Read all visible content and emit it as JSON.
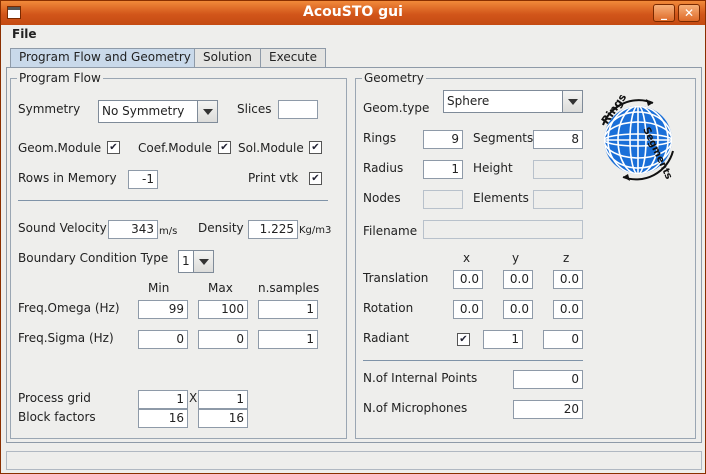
{
  "window": {
    "title": "AcouSTO gui"
  },
  "menubar": {
    "file": "File"
  },
  "tabs": [
    {
      "label": "Program Flow and Geometry",
      "active": true
    },
    {
      "label": "Solution",
      "active": false
    },
    {
      "label": "Execute",
      "active": false
    }
  ],
  "program_flow": {
    "legend": "Program Flow",
    "symmetry_label": "Symmetry",
    "symmetry_value": "No Symmetry",
    "slices_label": "Slices",
    "slices_value": "",
    "geom_module_label": "Geom.Module",
    "geom_module_checked": true,
    "coef_module_label": "Coef.Module",
    "coef_module_checked": true,
    "sol_module_label": "Sol.Module",
    "sol_module_checked": true,
    "rows_in_memory_label": "Rows in Memory",
    "rows_in_memory_value": "-1",
    "print_vtk_label": "Print vtk",
    "print_vtk_checked": true,
    "sound_velocity_label": "Sound Velocity",
    "sound_velocity_value": "343",
    "sound_velocity_unit": "m/s",
    "density_label": "Density",
    "density_value": "1.225",
    "density_unit": "Kg/m3",
    "bc_type_label": "Boundary Condition Type",
    "bc_type_value": "1",
    "col_min": "Min",
    "col_max": "Max",
    "col_nsamples": "n.samples",
    "freq_omega_label": "Freq.Omega (Hz)",
    "freq_omega_min": "99",
    "freq_omega_max": "100",
    "freq_omega_n": "1",
    "freq_sigma_label": "Freq.Sigma (Hz)",
    "freq_sigma_min": "0",
    "freq_sigma_max": "0",
    "freq_sigma_n": "1",
    "process_grid_label": "Process grid",
    "process_grid_a": "1",
    "process_grid_x": "X",
    "process_grid_b": "1",
    "block_factors_label": "Block factors",
    "block_factors_a": "16",
    "block_factors_b": "16"
  },
  "geometry": {
    "legend": "Geometry",
    "geom_type_label": "Geom.type",
    "geom_type_value": "Sphere",
    "rings_label": "Rings",
    "rings_value": "9",
    "segments_label": "Segments",
    "segments_value": "8",
    "radius_label": "Radius",
    "radius_value": "1",
    "height_label": "Height",
    "height_value": "",
    "nodes_label": "Nodes",
    "nodes_value": "",
    "elements_label": "Elements",
    "elements_value": "",
    "filename_label": "Filename",
    "filename_value": "",
    "col_x": "x",
    "col_y": "y",
    "col_z": "z",
    "translation_label": "Translation",
    "translation": [
      "0.0",
      "0.0",
      "0.0"
    ],
    "rotation_label": "Rotation",
    "rotation": [
      "0.0",
      "0.0",
      "0.0"
    ],
    "radiant_label": "Radiant",
    "radiant_checked": true,
    "radiant_y": "1",
    "radiant_z": "0",
    "internal_points_label": "N.of Internal Points",
    "internal_points_value": "0",
    "microphones_label": "N.of Microphones",
    "microphones_value": "20",
    "logo_rings_text": "Rings",
    "logo_segments_text": "Segments",
    "logo_icon": "sphere-logo-icon"
  },
  "colors": {
    "titlebar": "#d2561a",
    "tab_active": "#c9d9ea",
    "logo_blue": "#1a6fd8"
  }
}
